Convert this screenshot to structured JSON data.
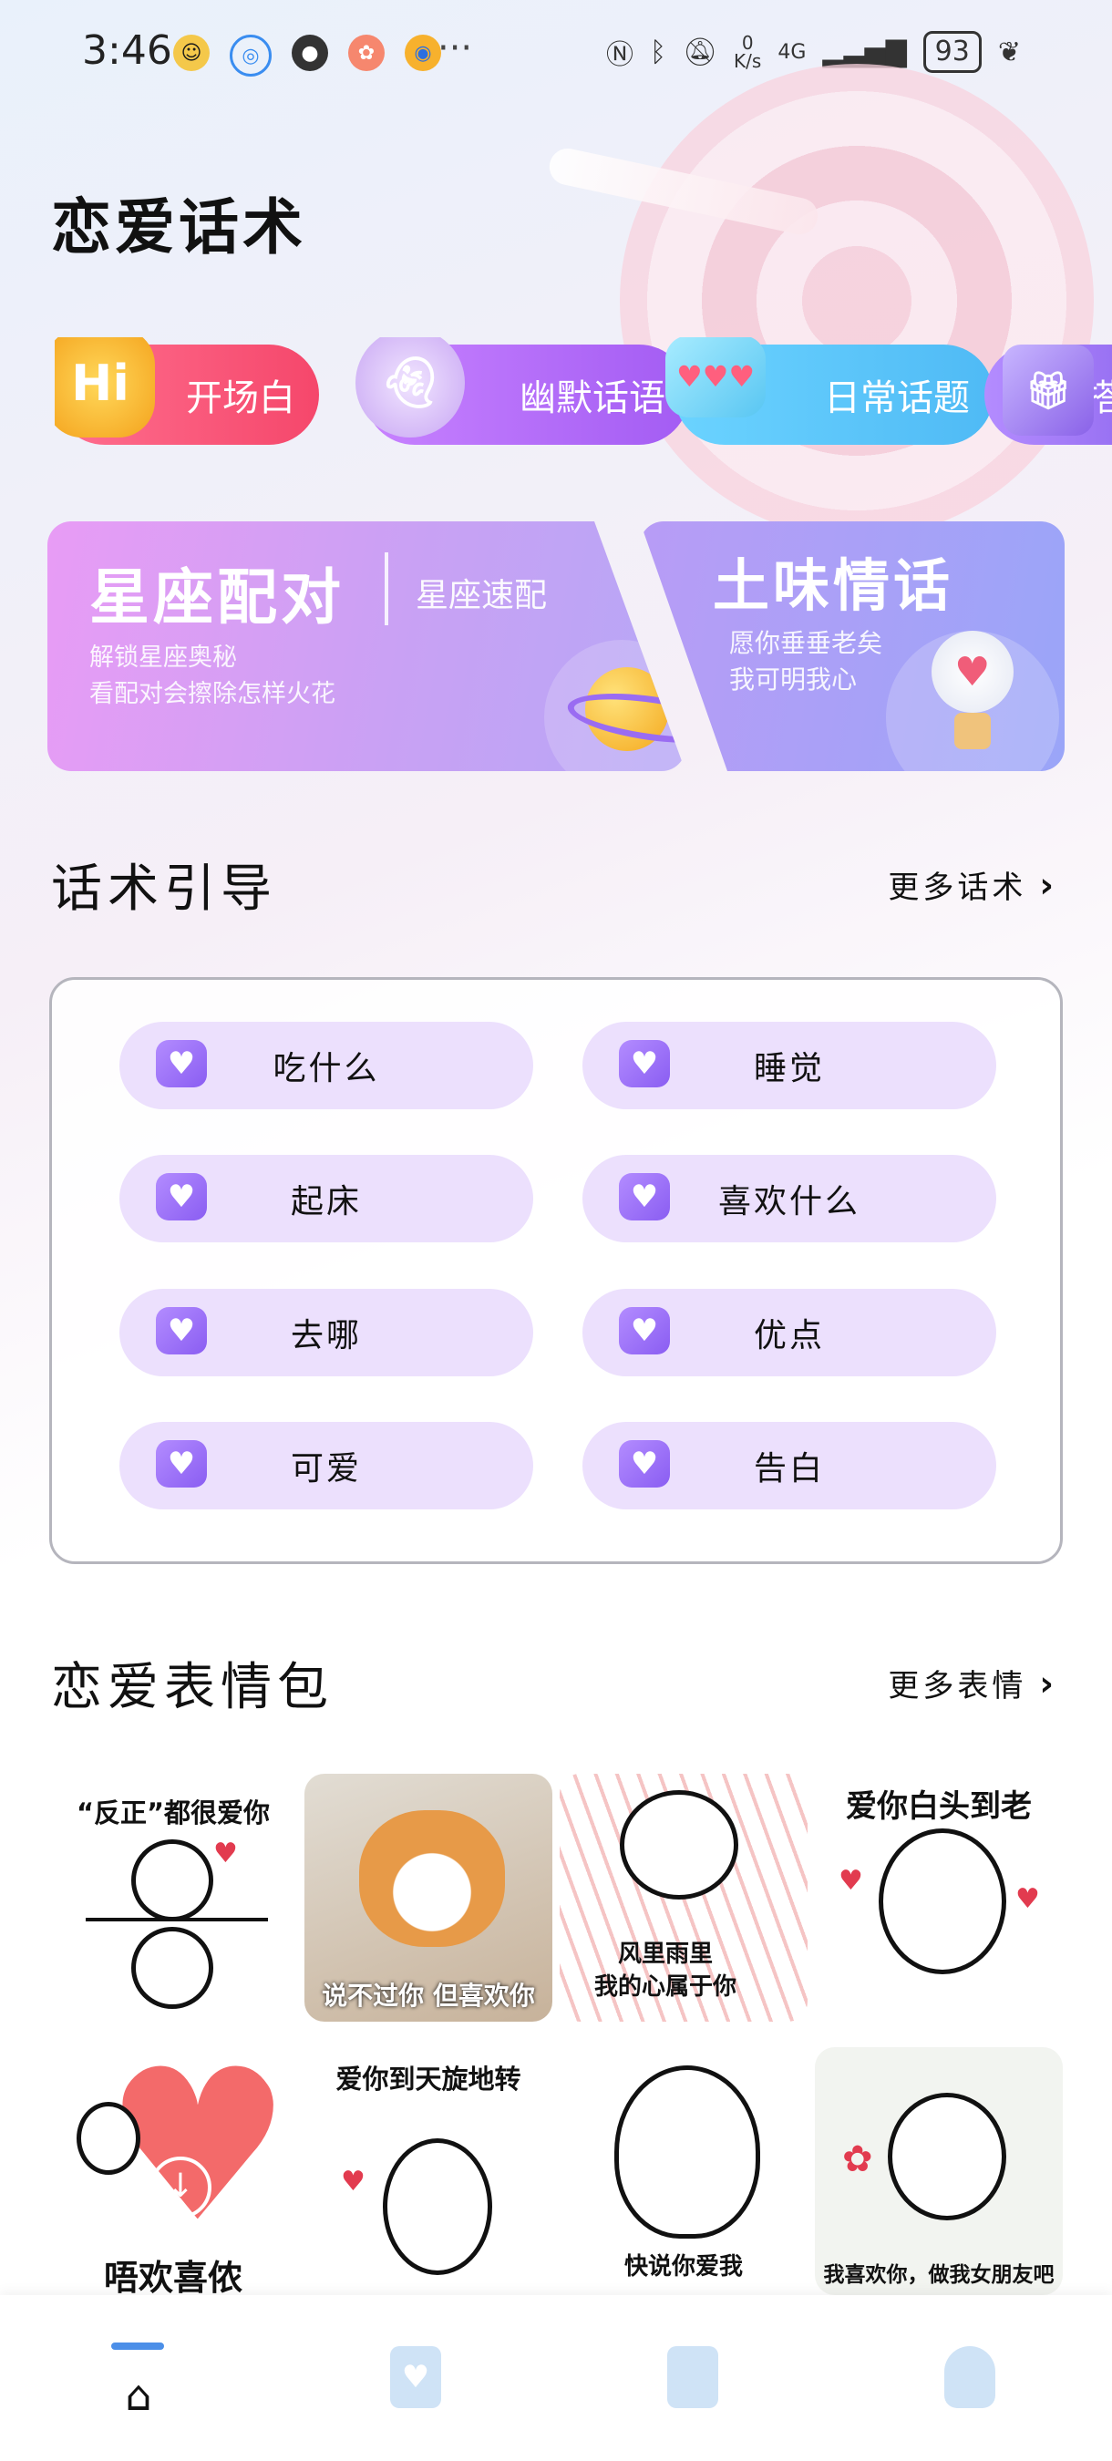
{
  "status_bar": {
    "time": "3:46",
    "more": "···",
    "net_speed": "0\nK/s",
    "network": "4G",
    "battery": "93"
  },
  "page_title": "恋爱话术",
  "categories": [
    {
      "label": "开场白",
      "icon": "hi-icon",
      "icon_text": "Hi"
    },
    {
      "label": "幽默话语",
      "icon": "ghost-icon",
      "icon_text": ""
    },
    {
      "label": "日常话题",
      "icon": "chat-bubble-icon",
      "icon_text": "♥♥♥"
    },
    {
      "label": "搭",
      "icon": "gift-box-icon",
      "icon_text": ""
    }
  ],
  "feature_cards": {
    "left": {
      "title": "星座配对",
      "subtitle": "星座速配",
      "desc_line1": "解锁星座奥秘",
      "desc_line2": "看配对会擦除怎样火花"
    },
    "right": {
      "title": "土味情话",
      "desc_line1": "愿你垂垂老矣",
      "desc_line2": "我可明我心"
    }
  },
  "guide": {
    "title": "话术引导",
    "more": "更多话术",
    "items": [
      "吃什么",
      "睡觉",
      "起床",
      "喜欢什么",
      "去哪",
      "优点",
      "可爱",
      "告白"
    ]
  },
  "stickers": {
    "title": "恋爱表情包",
    "more": "更多表情",
    "items": [
      {
        "caption": "“反正”都很爱你"
      },
      {
        "caption": "说不过你 但喜欢你"
      },
      {
        "caption": "风里雨里\n我的心属于你"
      },
      {
        "caption": "爱你白头到老"
      },
      {
        "caption": "唔欢喜侬"
      },
      {
        "caption": "爱你到天旋地转"
      },
      {
        "caption": "快说你爱我"
      },
      {
        "caption": "我喜欢你，做我女朋友吧"
      }
    ]
  },
  "bottom_nav": [
    {
      "name": "home",
      "icon": "home-icon",
      "active": true
    },
    {
      "name": "clipboard",
      "icon": "clipboard-heart-icon",
      "active": false
    },
    {
      "name": "book",
      "icon": "notebook-icon",
      "active": false
    },
    {
      "name": "profile",
      "icon": "person-icon",
      "active": false
    }
  ],
  "colors": {
    "accent": "#4c8fe8",
    "guide_item_bg": "#ece0fd",
    "heart_icon": "#8a5df2"
  }
}
